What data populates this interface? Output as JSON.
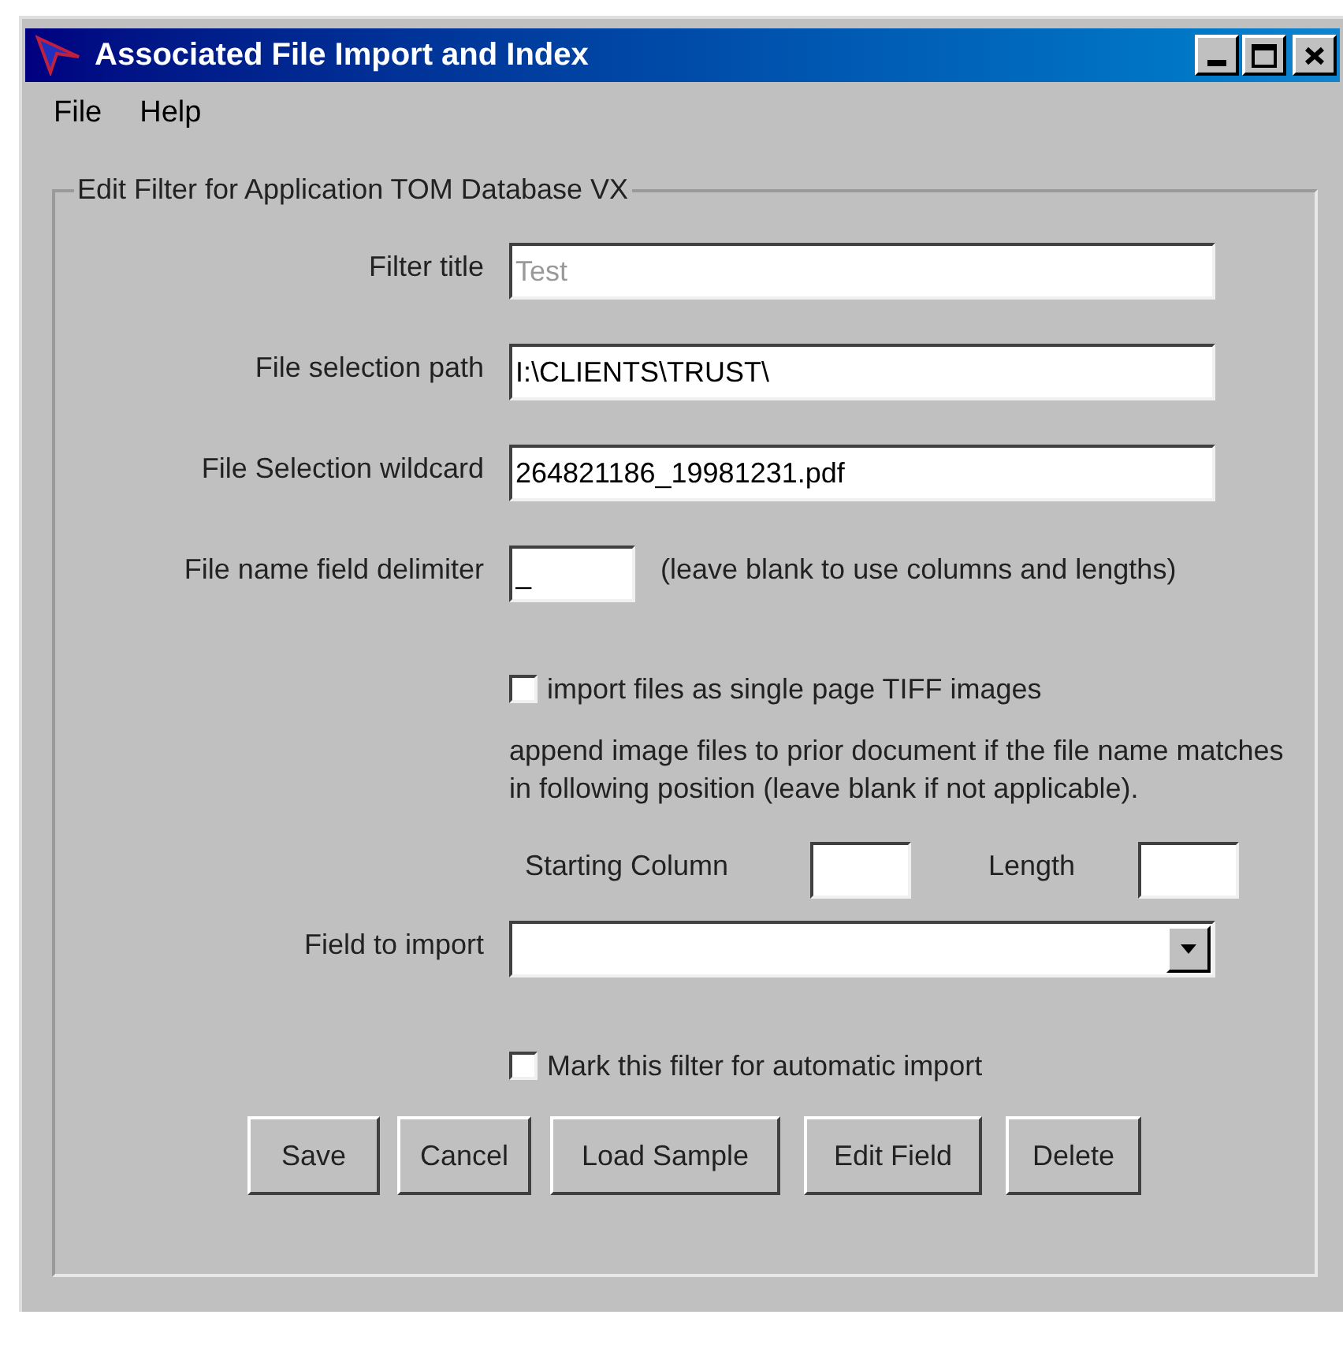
{
  "window": {
    "title": "Associated File Import and Index"
  },
  "menu": [
    {
      "label": "File"
    },
    {
      "label": "Help"
    }
  ],
  "group": {
    "title": "Edit Filter for Application TOM  Database VX"
  },
  "fields": [
    {
      "label": "Filter title",
      "value": "Test",
      "disabled": true
    },
    {
      "label": "File selection path",
      "value": "I:\\CLIENTS\\TRUST\\",
      "disabled": false
    },
    {
      "label": "File Selection wildcard",
      "value": "264821186_19981231.pdf",
      "disabled": false
    }
  ],
  "delimiter": {
    "label": "File name field delimiter",
    "value": "_",
    "hint": "(leave blank to use columns and lengths)"
  },
  "tiff_checkbox": {
    "label": "import files as single page TIFF images",
    "checked": false
  },
  "append_note": "append image files to prior document if the file name matches in following position (leave blank if not applicable).",
  "position": {
    "start_label": "Starting Column",
    "length_label": "Length"
  },
  "field_to_import": {
    "label": "Field to import"
  },
  "auto_checkbox": {
    "label": "Mark this filter for automatic import",
    "checked": false
  },
  "buttons": [
    "Save",
    "Cancel",
    "Load Sample",
    "Edit Field",
    "Delete"
  ]
}
